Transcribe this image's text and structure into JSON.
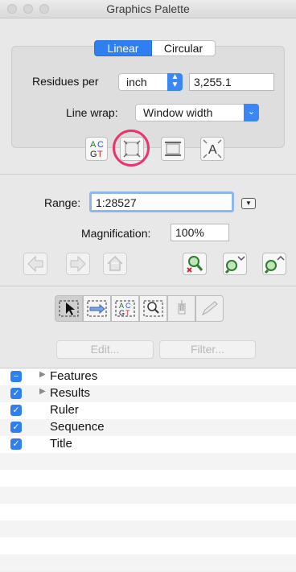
{
  "window": {
    "title": "Graphics Palette"
  },
  "view_mode": {
    "linear": "Linear",
    "circular": "Circular"
  },
  "residues": {
    "label": "Residues per",
    "unit": "inch",
    "value": "3,255.1"
  },
  "line_wrap": {
    "label": "Line wrap:",
    "value": "Window width"
  },
  "range": {
    "label": "Range:",
    "value": "1:28527"
  },
  "magnification": {
    "label": "Magnification:",
    "value": "100%"
  },
  "actions": {
    "edit": "Edit...",
    "filter": "Filter..."
  },
  "layers": [
    {
      "label": "Features",
      "check": "−",
      "disclosure": "▶"
    },
    {
      "label": "Results",
      "check": "✓",
      "disclosure": "▶"
    },
    {
      "label": "Ruler",
      "check": "✓",
      "disclosure": ""
    },
    {
      "label": "Sequence",
      "check": "✓",
      "disclosure": ""
    },
    {
      "label": "Title",
      "check": "✓",
      "disclosure": ""
    }
  ],
  "colors": {
    "accent": "#2f7ff0",
    "highlight_ring": "#e8356d"
  },
  "icons": {
    "seq_letters": [
      "A",
      "C",
      "G",
      "T"
    ],
    "text_tool": "A"
  }
}
